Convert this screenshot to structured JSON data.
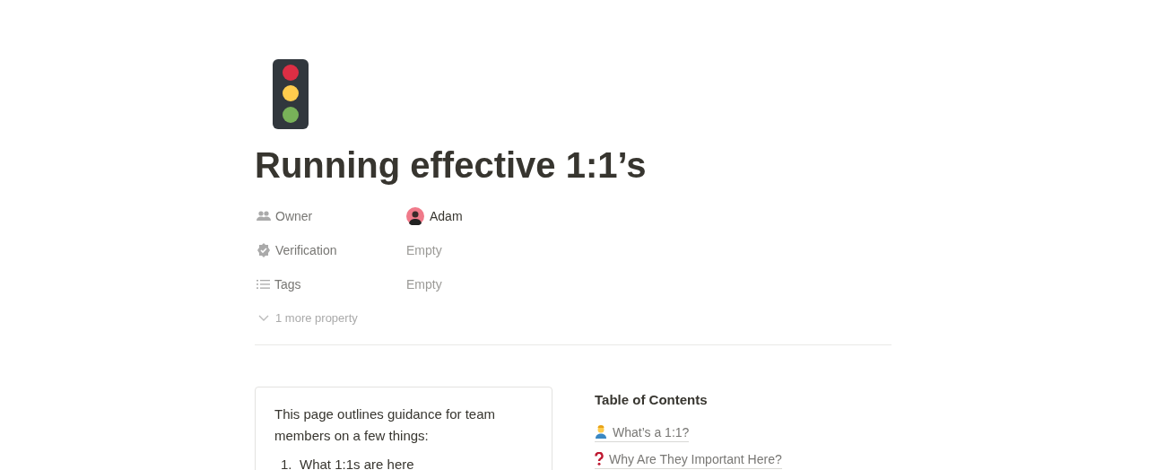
{
  "page": {
    "title": "Running effective 1:1’s"
  },
  "properties": [
    {
      "label": "Owner",
      "kind": "person",
      "value": "Adam"
    },
    {
      "label": "Verification",
      "kind": "empty",
      "value": "Empty"
    },
    {
      "label": "Tags",
      "kind": "empty",
      "value": "Empty"
    }
  ],
  "more_properties": "1 more property",
  "callout": {
    "text": "This page outlines guidance for team members on a few things:",
    "list": [
      {
        "number": "1.",
        "text": "What 1:1s are here"
      }
    ]
  },
  "toc": {
    "title": "Table of Contents",
    "items": [
      {
        "text": "What’s a 1:1?"
      },
      {
        "text": "Why Are They Important Here?"
      }
    ]
  }
}
